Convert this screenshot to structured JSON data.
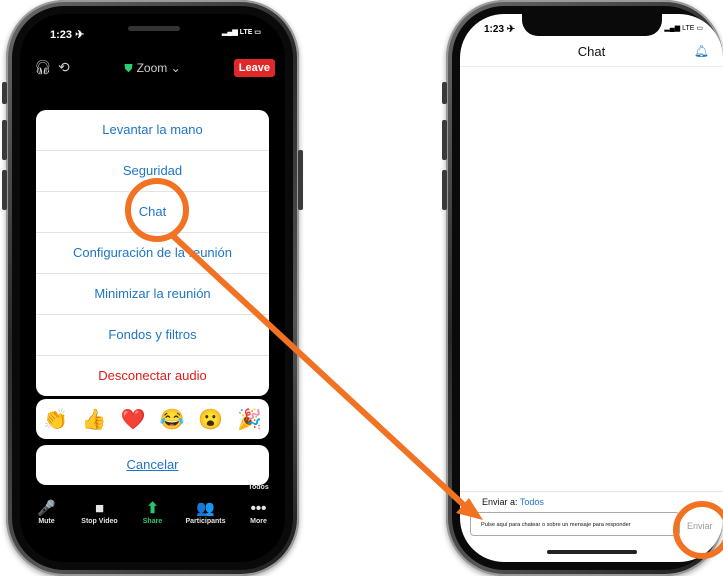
{
  "left_phone": {
    "status_time": "1:23 ✈",
    "status_signal": "LTE",
    "meeting_title": "Zoom",
    "leave_label": "Leave",
    "menu_items": [
      {
        "label": "Levantar la mano",
        "style": "normal"
      },
      {
        "label": "Seguridad",
        "style": "normal"
      },
      {
        "label": "Chat",
        "style": "normal"
      },
      {
        "label": "Configuración de la reunión",
        "style": "normal"
      },
      {
        "label": "Minimizar la reunión",
        "style": "normal"
      },
      {
        "label": "Fondos y filtros",
        "style": "normal"
      },
      {
        "label": "Desconectar audio",
        "style": "danger"
      }
    ],
    "reactions": [
      "👏",
      "👍",
      "❤️",
      "😂",
      "😮",
      "🎉"
    ],
    "cancel_label": "Cancelar",
    "toolbar": [
      {
        "label": "Mute",
        "icon": "mic-icon",
        "glyph": "🎤"
      },
      {
        "label": "Stop Video",
        "icon": "video-camera-icon",
        "glyph": "■"
      },
      {
        "label": "Share",
        "icon": "share-icon",
        "glyph": "⬆"
      },
      {
        "label": "Participants",
        "icon": "participants-icon",
        "glyph": "👥"
      },
      {
        "label": "More",
        "icon": "more-icon",
        "glyph": "•••"
      }
    ],
    "more_top_label": "Todos"
  },
  "right_phone": {
    "status_time": "1:23 ✈",
    "status_signal": "LTE",
    "header_title": "Chat",
    "send_to_prefix": "Enviar a:",
    "send_to_value": "Todos",
    "message_placeholder": "Pulse aquí para chatear o sobre un mensaje para responder",
    "send_label": "Enviar"
  },
  "colors": {
    "accent_blue": "#1f75c8",
    "danger_red": "#e01b1b",
    "highlight_orange": "#f07222",
    "share_green": "#28c76f"
  }
}
